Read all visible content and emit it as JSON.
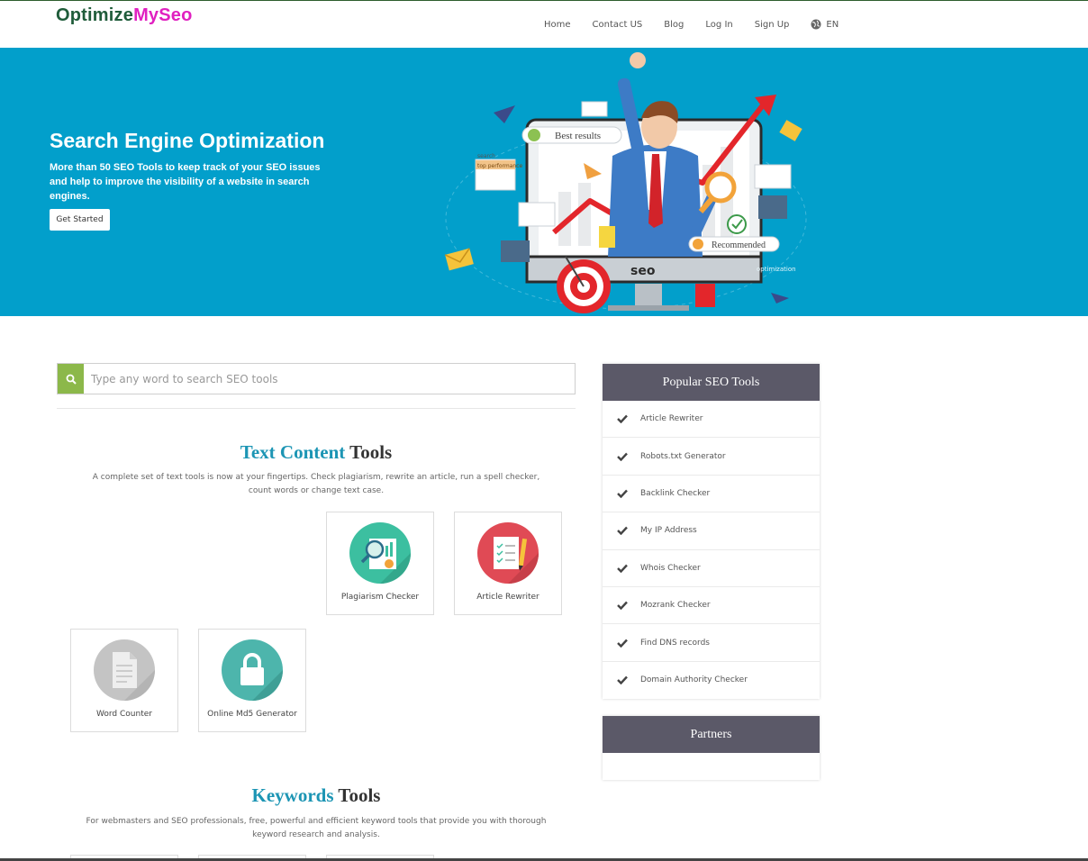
{
  "brand": {
    "part1": "Optimize",
    "part2": "MySeo",
    "color1": "#1f5c3a",
    "color2": "#e020c0"
  },
  "nav": {
    "items": [
      "Home",
      "Contact US",
      "Blog",
      "Log In",
      "Sign Up"
    ],
    "language": "EN",
    "language_icon": "globe-icon"
  },
  "hero": {
    "title": "Search Engine Optimization",
    "subtitle": "More than 50 SEO Tools to keep track of your SEO issues and help to improve the visibility of a website in search engines.",
    "button": "Get Started",
    "background": "#029fcb",
    "art_labels": {
      "best_results": "Best results",
      "recommended": "Recommended",
      "search": "search",
      "top_performance": "top performance",
      "optimization": "optimization",
      "seo": "seo"
    }
  },
  "search": {
    "placeholder": "Type any word to search SEO tools",
    "icon": "search-icon",
    "icon_bg": "#8cb84a"
  },
  "sections": {
    "text": {
      "title_highlight": "Text Content",
      "title_rest": " Tools",
      "description": "A complete set of text tools is now at your fingertips. Check plagiarism, rewrite an article, run a spell checker, count words or change text case.",
      "tools": [
        {
          "label": "Plagiarism Checker",
          "icon": "magnifier-report-icon",
          "color": "#3cbfa0"
        },
        {
          "label": "Article Rewriter",
          "icon": "checklist-pencil-icon",
          "color": "#e04a55"
        },
        {
          "label": "Word Counter",
          "icon": "document-icon",
          "color": "#c4c4c4"
        },
        {
          "label": "Online Md5 Generator",
          "icon": "lock-icon",
          "color": "#4db5ac"
        }
      ]
    },
    "keywords": {
      "title_highlight": "Keywords",
      "title_rest": " Tools",
      "description": "For webmasters and SEO professionals, free, powerful and efficient keyword tools that provide you with thorough keyword research and analysis."
    }
  },
  "sidebar": {
    "popular": {
      "title": "Popular SEO Tools",
      "items": [
        "Article Rewriter",
        "Robots.txt Generator",
        "Backlink Checker",
        "My IP Address",
        "Whois Checker",
        "Mozrank Checker",
        "Find DNS records",
        "Domain Authority Checker"
      ]
    },
    "partners": {
      "title": "Partners"
    },
    "header_color": "#5b5968"
  }
}
